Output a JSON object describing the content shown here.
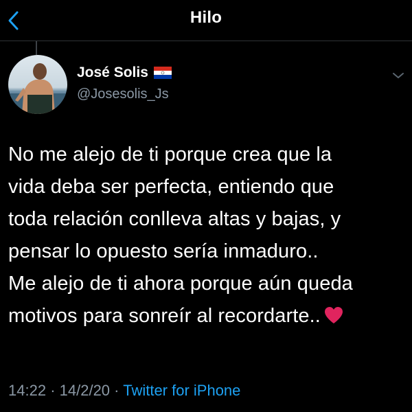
{
  "header": {
    "title": "Hilo",
    "back_icon": "chevron-left-icon"
  },
  "tweet": {
    "author": {
      "name": "José Solis",
      "flag": "paraguay-flag-icon",
      "handle": "@Josesolis_Js"
    },
    "lines": [
      "No me alejo de ti porque crea que la",
      "vida deba ser perfecta, entiendo que",
      "toda relación conlleva altas y bajas, y",
      "pensar lo opuesto sería inmaduro..",
      "Me alejo de ti ahora porque aún queda",
      "motivos para sonreír al recordarte.."
    ],
    "emoji": "red-heart-icon",
    "time": "14:22",
    "separator": "·",
    "date": "14/2/20",
    "source": "Twitter for iPhone"
  },
  "colors": {
    "background": "#000000",
    "accent": "#1da1f2",
    "secondary_text": "#8b98a5",
    "heart": "#e0245e"
  }
}
